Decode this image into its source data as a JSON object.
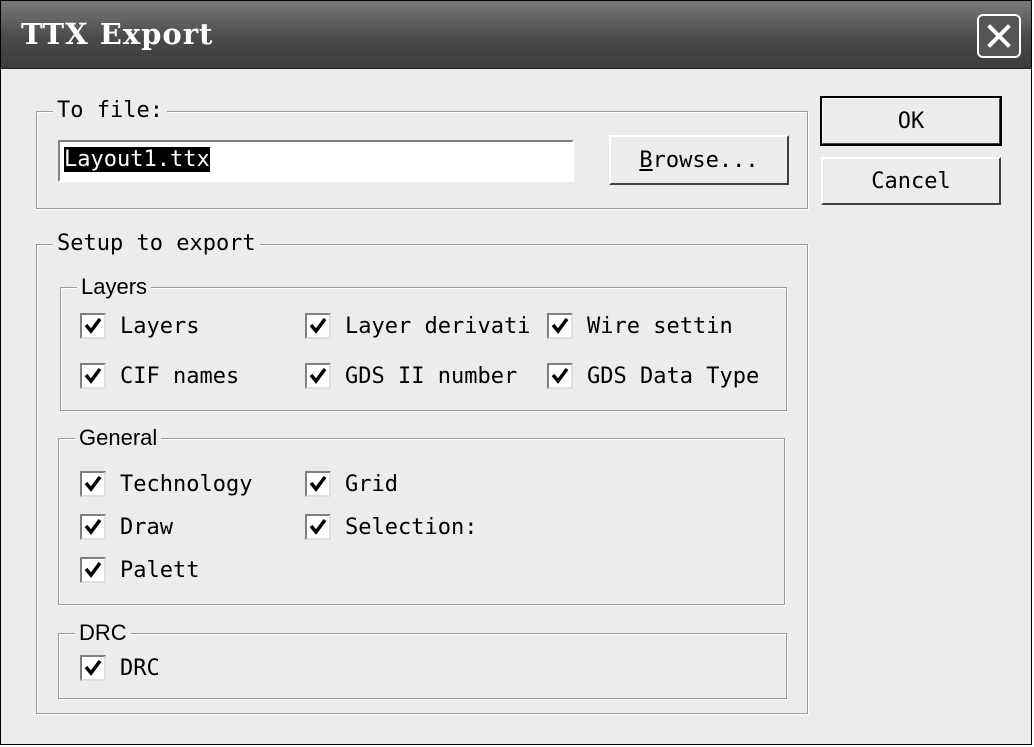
{
  "window": {
    "title": "TTX Export"
  },
  "to_file": {
    "legend": "To file:",
    "filename": "Layout1.ttx",
    "browse_label": "Browse..."
  },
  "buttons": {
    "ok": "OK",
    "cancel": "Cancel"
  },
  "setup": {
    "legend": "Setup to export",
    "layers": {
      "legend": "Layers",
      "items": [
        {
          "label": "Layers",
          "checked": true
        },
        {
          "label": "Layer derivati",
          "checked": true
        },
        {
          "label": "Wire settin",
          "checked": true
        },
        {
          "label": "CIF names",
          "checked": true
        },
        {
          "label": "GDS II number",
          "checked": true
        },
        {
          "label": "GDS Data Type",
          "checked": true
        }
      ]
    },
    "general": {
      "legend": "General",
      "items": [
        {
          "label": "Technology",
          "checked": true
        },
        {
          "label": "Grid",
          "checked": true
        },
        {
          "label": "Draw",
          "checked": true
        },
        {
          "label": "Selection:",
          "checked": true
        },
        {
          "label": "Palett",
          "checked": true
        }
      ]
    },
    "drc": {
      "legend": "DRC",
      "items": [
        {
          "label": "DRC",
          "checked": true
        }
      ]
    }
  },
  "icons": {
    "close": "close-x-icon",
    "check": "checkmark-icon"
  }
}
